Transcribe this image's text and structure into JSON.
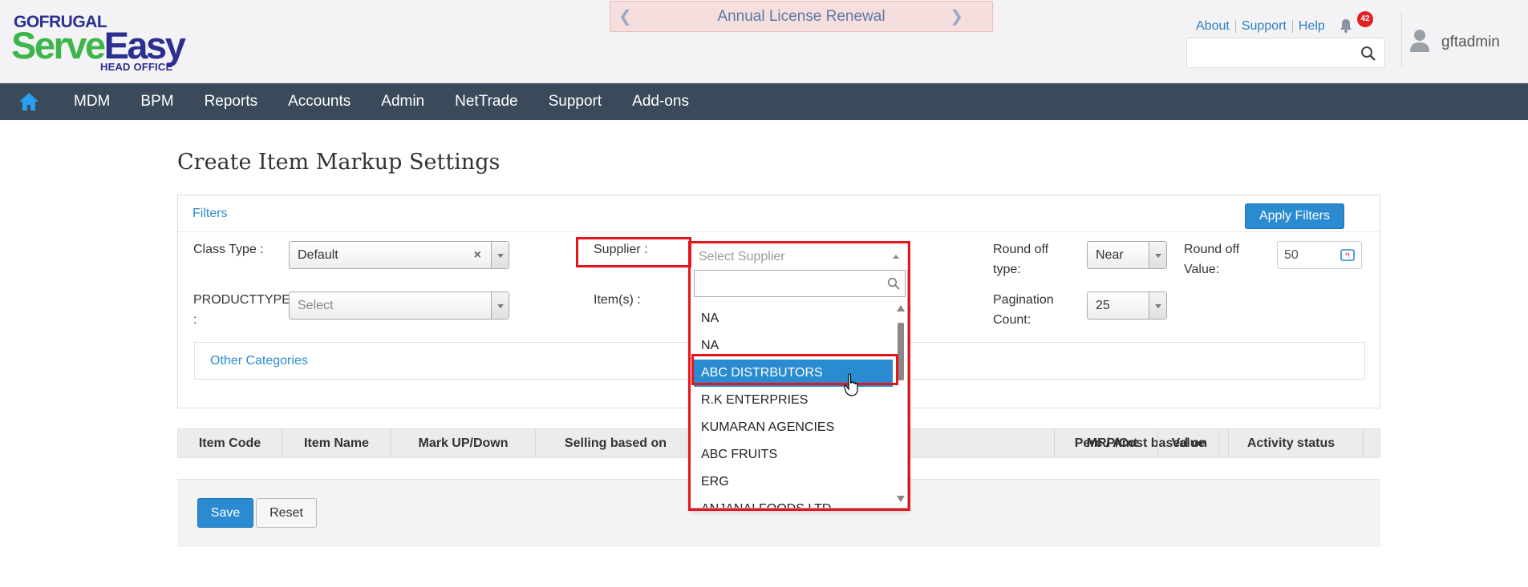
{
  "header": {
    "logo": {
      "brand": "GOFRUGAL",
      "product_part1": "Serve",
      "product_part2": "Easy",
      "subtitle": "HEAD OFFICE"
    },
    "banner": {
      "text": "Annual License Renewal"
    },
    "top_links": [
      "About",
      "Support",
      "Help"
    ],
    "notifications_count": "42",
    "search": {
      "placeholder": ""
    },
    "username": "gftadmin"
  },
  "nav": {
    "items": [
      "MDM",
      "BPM",
      "Reports",
      "Accounts",
      "Admin",
      "NetTrade",
      "Support",
      "Add-ons"
    ]
  },
  "page": {
    "title": "Create Item Markup Settings"
  },
  "filters": {
    "heading": "Filters",
    "apply_label": "Apply Filters",
    "class_type": {
      "label": "Class Type :",
      "value": "Default"
    },
    "supplier": {
      "label": "Supplier :",
      "placeholder": "Select Supplier"
    },
    "round_off_type": {
      "label_line1": "Round off",
      "label_line2": "type:",
      "value": "Near"
    },
    "round_off_value": {
      "label_line1": "Round off",
      "label_line2": "Value:",
      "value": "50"
    },
    "product_type": {
      "label_line1": "PRODUCTTYPE",
      "label_line2": ":",
      "placeholder": "Select"
    },
    "items": {
      "label": "Item(s) :"
    },
    "pagination": {
      "label_line1": "Pagination",
      "label_line2": "Count:",
      "value": "25"
    },
    "other_categories": "Other Categories"
  },
  "supplier_dropdown": {
    "options": [
      "NA",
      "NA",
      "ABC DISTRBUTORS",
      "R.K ENTERPRIES",
      "KUMARAN AGENCIES",
      "ABC FRUITS",
      "ERG",
      "ANJANAI FOODS LTD"
    ],
    "highlighted_index": 2
  },
  "table": {
    "columns": [
      "Item Code",
      "Item Name",
      "Mark UP/Down",
      "Selling based on",
      "MRP/Cost based on",
      "Perc / Amt",
      "Value",
      "Activity status"
    ]
  },
  "actions": {
    "save": "Save",
    "reset": "Reset"
  },
  "colors": {
    "nav_bg": "#3b4a5b",
    "accent": "#2a8bd0",
    "highlight_red": "#e8141c",
    "brand_green": "#3cb54a",
    "brand_blue": "#2c2f8f"
  }
}
